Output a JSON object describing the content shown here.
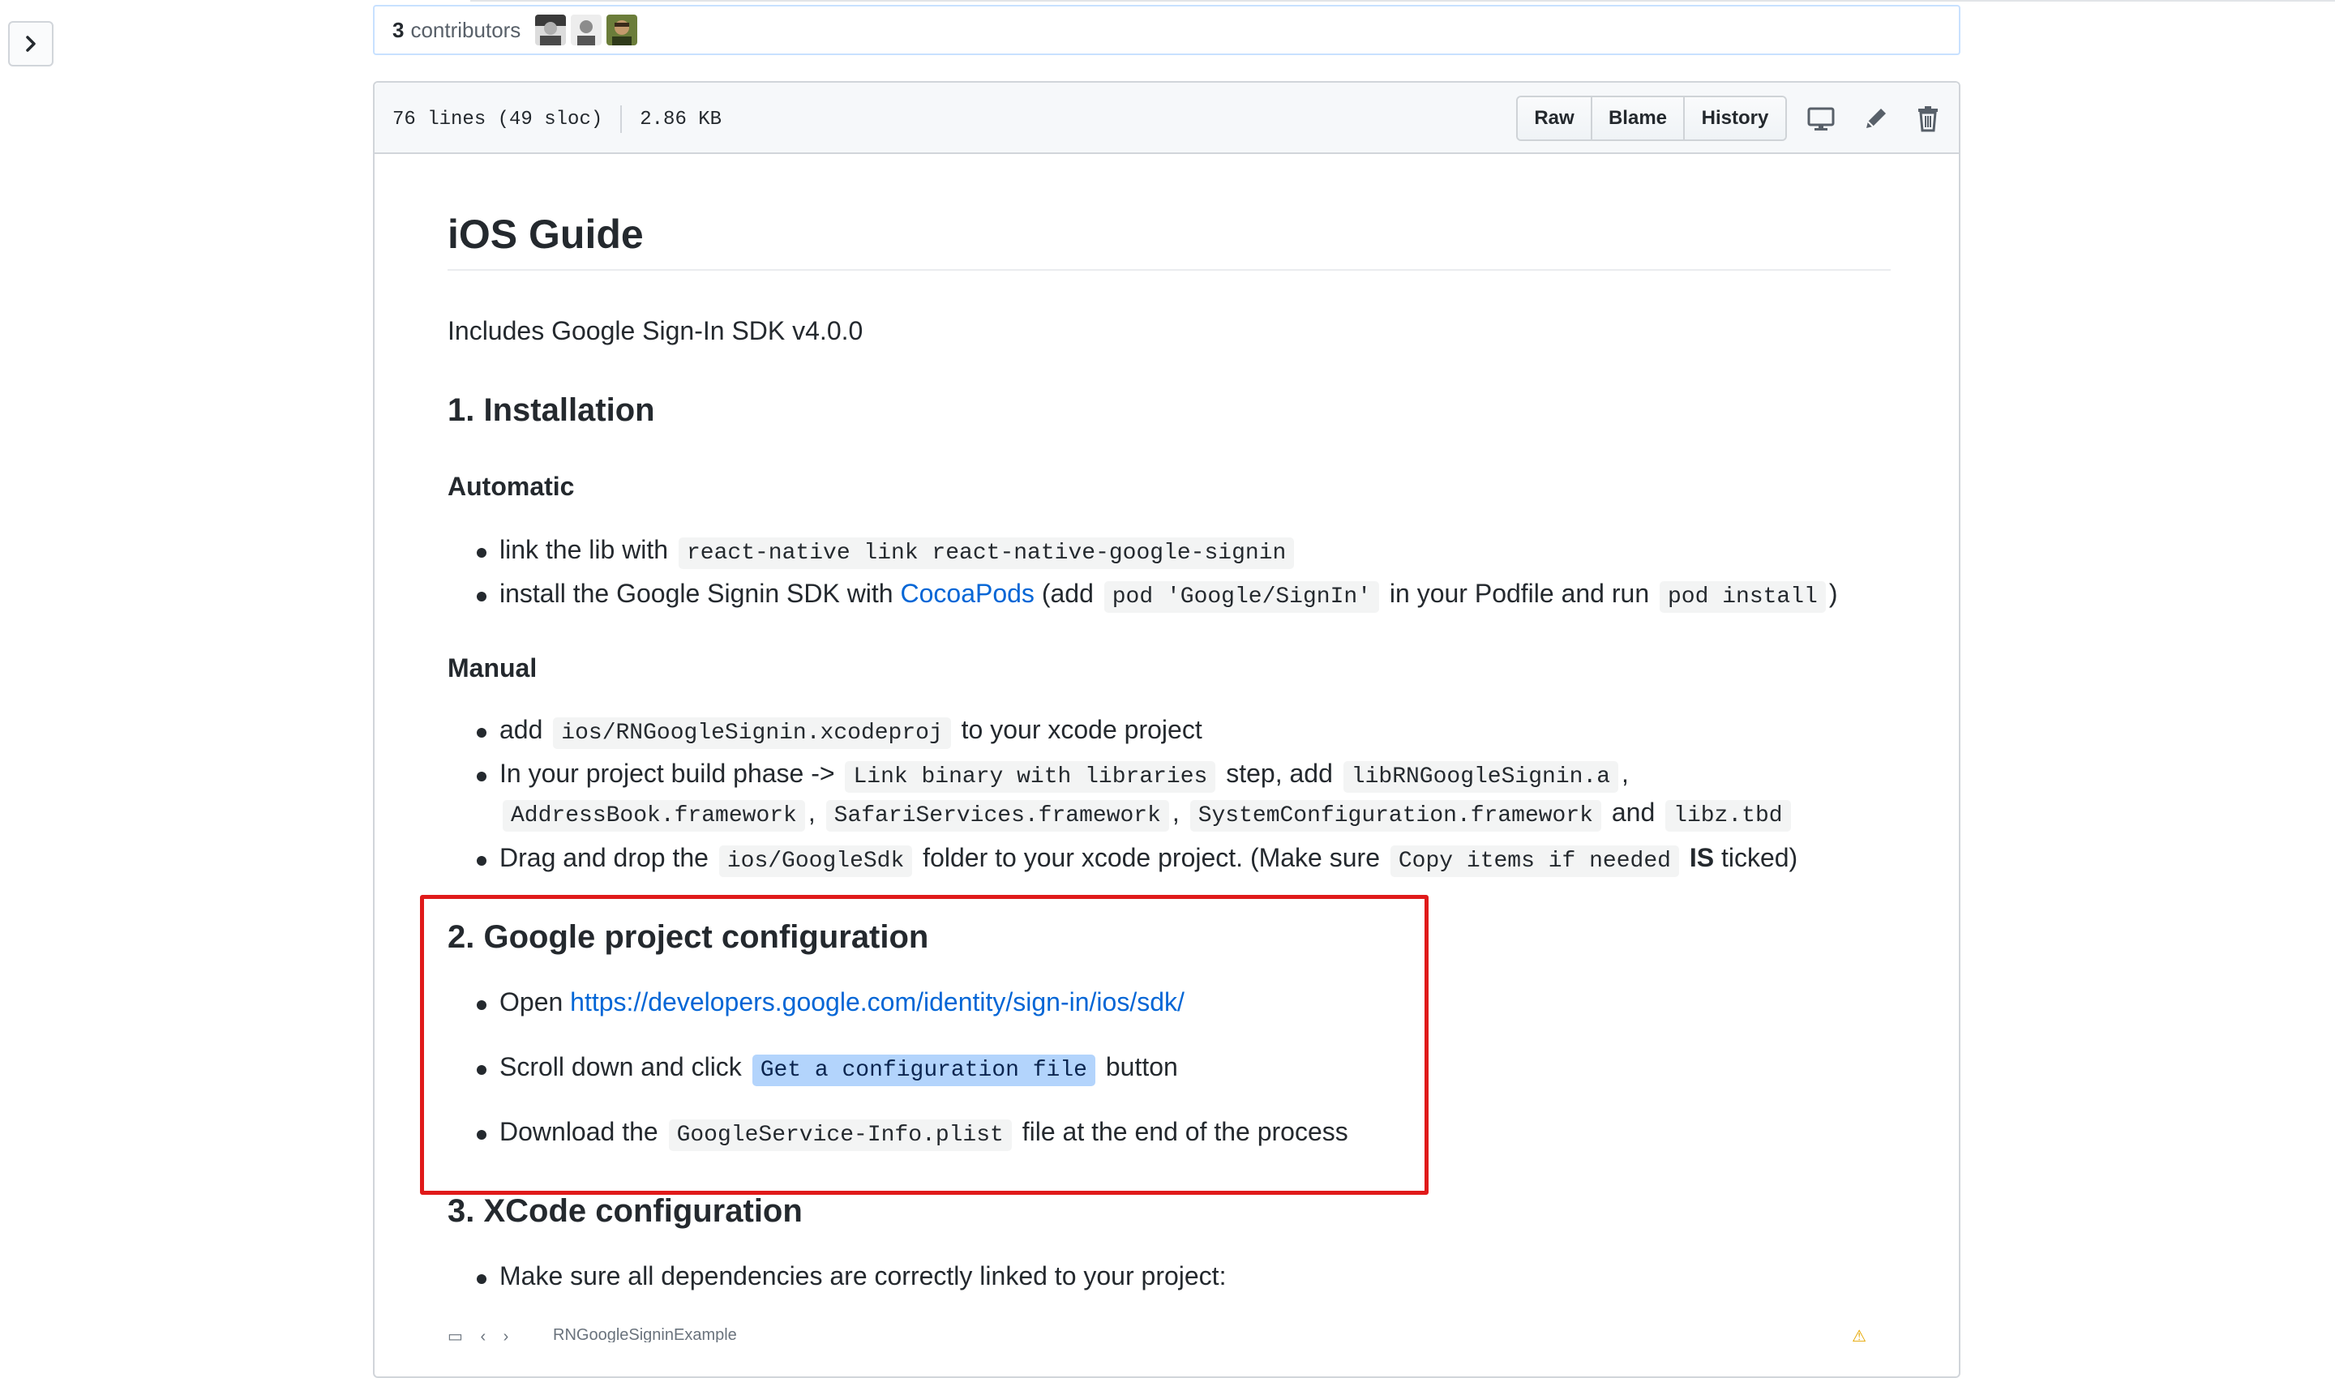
{
  "contributors": {
    "count": "3",
    "label": "contributors"
  },
  "file_header": {
    "lines": "76 lines (49 sloc)",
    "size": "2.86 KB",
    "buttons": {
      "raw": "Raw",
      "blame": "Blame",
      "history": "History"
    },
    "icons": [
      "desktop-icon",
      "pencil-icon",
      "trash-icon"
    ]
  },
  "readme": {
    "title": "iOS Guide",
    "intro": "Includes Google Sign-In SDK v4.0.0",
    "installation": {
      "heading": "1. Installation",
      "automatic": {
        "heading": "Automatic",
        "item1": {
          "text": "link the lib with",
          "code": "react-native link react-native-google-signin"
        },
        "item2": {
          "text_a": "install the Google Signin SDK with",
          "link": "CocoaPods",
          "text_b": "(add",
          "code_a": "pod 'Google/SignIn'",
          "text_c": "in your Podfile and run",
          "code_b": "pod install",
          "text_d": ")"
        }
      },
      "manual": {
        "heading": "Manual",
        "item1": {
          "text_a": "add",
          "code": "ios/RNGoogleSignin.xcodeproj",
          "text_b": "to your xcode project"
        },
        "item2": {
          "text_a": "In your project build phase ->",
          "code_a": "Link binary with libraries",
          "text_b": "step, add",
          "code_b": "libRNGoogleSignin.a",
          "comma1": ",",
          "code_c": "AddressBook.framework",
          "comma2": ",",
          "code_d": "SafariServices.framework",
          "comma3": ",",
          "code_e": "SystemConfiguration.framework",
          "text_c": "and",
          "code_f": "libz.tbd"
        },
        "item3": {
          "text_a": "Drag and drop the",
          "code_a": "ios/GoogleSdk",
          "text_b": "folder to your xcode project. (Make sure",
          "code_b": "Copy items if needed",
          "bold": "IS",
          "text_c": "ticked)"
        }
      }
    },
    "google_config": {
      "heading": "2. Google project configuration",
      "item1": {
        "text": "Open",
        "link": "https://developers.google.com/identity/sign-in/ios/sdk/"
      },
      "item2": {
        "text_a": "Scroll down and click",
        "code": "Get a configuration file",
        "text_b": "button"
      },
      "item3": {
        "text_a": "Download the",
        "code": "GoogleService-Info.plist",
        "text_b": "file at the end of the process"
      }
    },
    "xcode_config": {
      "heading": "3. XCode configuration",
      "item1": "Make sure all dependencies are correctly linked to your project:",
      "screenshot_caption": "RNGoogleSigninExample"
    }
  },
  "colors": {
    "link": "#0366d6",
    "highlight_box": "#e01a1a",
    "selection": "#b3d4fc"
  }
}
